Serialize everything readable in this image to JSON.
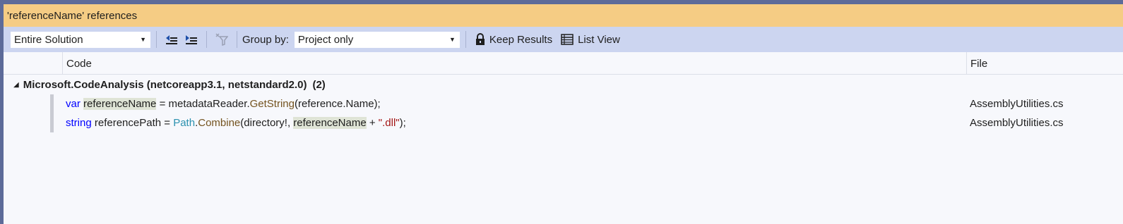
{
  "title": "'referenceName' references",
  "toolbar": {
    "scope": "Entire Solution",
    "group_by_label": "Group by:",
    "group_by_value": "Project only",
    "keep_results": "Keep Results",
    "list_view": "List View"
  },
  "columns": {
    "code": "Code",
    "file": "File"
  },
  "group": {
    "label": "Microsoft.CodeAnalysis (netcoreapp3.1, netstandard2.0)",
    "count": "(2)"
  },
  "rows": [
    {
      "tokens": [
        "var",
        " ",
        "referenceName",
        " = ",
        "metadataReader",
        ".",
        "GetString",
        "(",
        "reference",
        ".",
        "Name",
        ");"
      ],
      "file": "AssemblyUtilities.cs"
    },
    {
      "tokens": [
        "string",
        " ",
        "referencePath",
        " = ",
        "Path",
        ".",
        "Combine",
        "(",
        "directory!",
        ", ",
        "referenceName",
        " + ",
        "\".dll\"",
        ");"
      ],
      "file": "AssemblyUtilities.cs"
    }
  ],
  "colors": {
    "title_bg": "#f5cc84",
    "toolbar_bg": "#ccd5f0",
    "keyword": "#0000ff",
    "type": "#2b91af",
    "method": "#74531f",
    "string": "#a31515",
    "highlight": "#dfe4d6"
  },
  "icons": [
    "previous-location-icon",
    "next-location-icon",
    "clear-filter-icon",
    "lock-icon",
    "list-view-icon",
    "dropdown-arrow-icon",
    "collapse-triangle-icon"
  ]
}
